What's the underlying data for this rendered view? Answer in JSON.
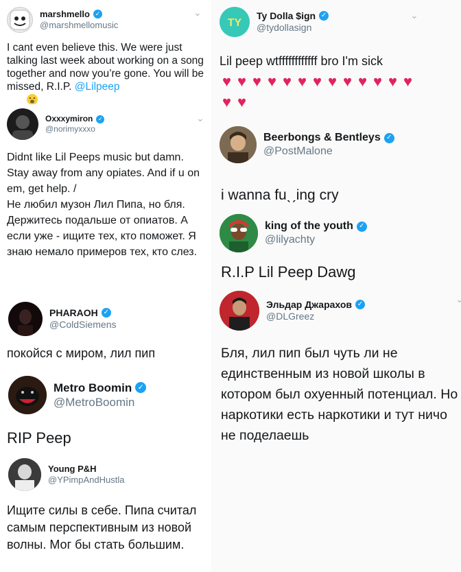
{
  "tweets_left": [
    {
      "name": "marshmello",
      "handle": "@marshmellomusic",
      "verified": true,
      "text": "I cant even believe this. We were just talking last week about working on a song together and now you’re gone. You will be missed, R.I.P. ",
      "mention": "@Lilpeep",
      "emoji_icon": "face-emoji-icon"
    },
    {
      "name": "Oxxxymiron",
      "handle": "@norimyxxxo",
      "verified": true,
      "text": "Didnt like Lil Peeps music but damn. Stay away from any opiates. And if u on em, get help. /\nНе любил музон Лил Пипа, но бля. Держитесь подальше от опиатов. А если уже - ищите тех, кто поможет. Я знаю немало примеров тех, кто слез."
    },
    {
      "name": "PHARAOH",
      "handle": "@ColdSiemens",
      "verified": true,
      "text": "покойся с миром, лил пип"
    },
    {
      "name": "Metro Boomin",
      "handle": "@MetroBoomin",
      "verified": true,
      "text": "RIP Peep"
    },
    {
      "name": "Young P&H",
      "handle": "@YPimpAndHustla",
      "verified": false,
      "text": "Ищите силы в себе. Пипа считал самым перспективным из новой волны. Мог бы стать большим."
    }
  ],
  "tweets_right": [
    {
      "name": "Ty Dolla $ign",
      "handle": "@tydollasign",
      "verified": true,
      "text": "Lil peep wtffffffffffff bro I'm sick",
      "heart_count": 15,
      "heart_icon": "red-heart-icon"
    },
    {
      "name": "Beerbongs & Bentleys",
      "handle": "@PostMalone",
      "verified": true,
      "text": "i wanna fuˎˏing cry"
    },
    {
      "name": "king of the youth",
      "handle": "@lilyachty",
      "verified": true,
      "text": "R.I.P Lil Peep Dawg"
    },
    {
      "name": "Эльдар Джарахов",
      "handle": "@DLGreez",
      "verified": true,
      "text": "Бля, лил пип был чуть ли не единственным из новой школы в котором был охуенный потенциал. Но наркотики есть наркотики и тут ничо не поделаешь"
    }
  ],
  "colors": {
    "link": "#1da1f2",
    "handle": "#657786",
    "verified": "#1da1f2",
    "heart": "#e0245e"
  }
}
